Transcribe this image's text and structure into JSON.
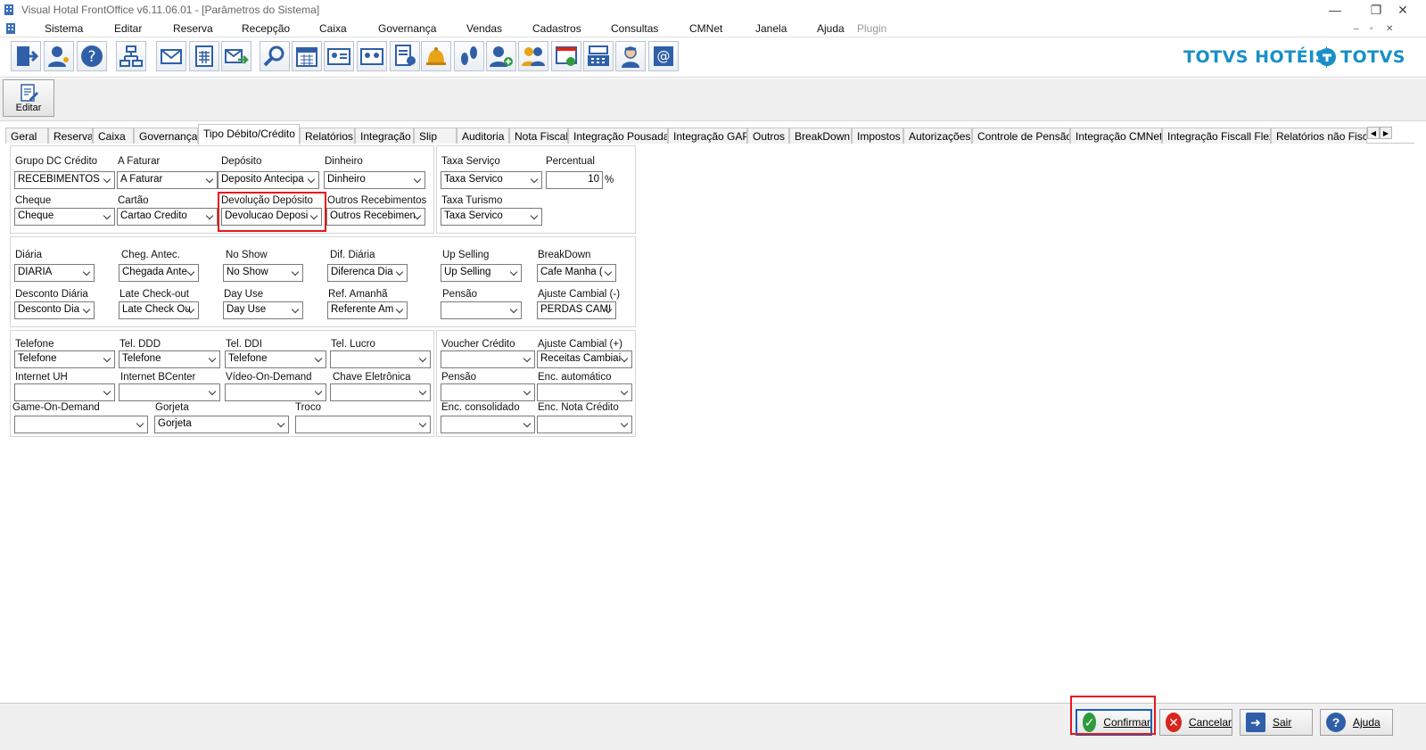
{
  "window": {
    "title": "Visual Hotal FrontOffice v6.11.06.01 - [Parâmetros do Sistema]",
    "minimize": "—",
    "restore": "❐",
    "close": "✕"
  },
  "menu": {
    "items": [
      "Sistema",
      "Editar",
      "Reserva",
      "Recepção",
      "Caixa",
      "Governança",
      "Vendas",
      "Cadastros",
      "Consultas",
      "CMNet",
      "Janela",
      "Ajuda"
    ],
    "plugin": "Plugin",
    "mdi": [
      "–",
      "▫",
      "✕"
    ]
  },
  "toolbar": {
    "icons": [
      "exit-icon",
      "user-key-icon",
      "help-icon",
      "org-chart-icon",
      "mail-icon",
      "calculator-icon",
      "mail-send-icon",
      "search-icon",
      "calendar-icon",
      "guest-card-icon",
      "guest-card-2-icon",
      "document-user-icon",
      "bell-icon",
      "footprints-icon",
      "add-user-icon",
      "users-group-icon",
      "invoice-icon",
      "cash-register-icon",
      "maid-icon",
      "email-at-icon"
    ],
    "brand_hotels": "TOTVS HOTÉIS",
    "brand_totvs": "TOTVS"
  },
  "subbar": {
    "edit_label": "Editar"
  },
  "tabs": {
    "items": [
      "Geral",
      "Reserva",
      "Caixa",
      "Governança",
      "Tipo Débito/Crédito",
      "Relatórios",
      "Integração",
      "Slip",
      "Auditoria",
      "Nota Fiscal",
      "Integração Pousada",
      "Integração GAP",
      "Outros",
      "BreakDown",
      "Impostos",
      "Autorizações",
      "Controle de Pensão",
      "Integração CMNet",
      "Integração Fiscall Flex",
      "Relatórios não Fiscais"
    ],
    "active": "Tipo Débito/Crédito",
    "scroll_left": "◀",
    "scroll_right": "▶"
  },
  "panel1": {
    "grupo_dc_label": "Grupo DC Crédito",
    "grupo_dc_value": "RECEBIMENTOS",
    "a_faturar_label": "A Faturar",
    "a_faturar_value": "A Faturar",
    "deposito_label": "Depósito",
    "deposito_value": "Deposito Antecipa",
    "dinheiro_label": "Dinheiro",
    "dinheiro_value": "Dinheiro",
    "cheque_label": "Cheque",
    "cheque_value": "Cheque",
    "cartao_label": "Cartão",
    "cartao_value": "Cartao Credito",
    "devolucao_label": "Devolução Depósito",
    "devolucao_value": "Devolucao Deposi",
    "outros_label": "Outros Recebimentos",
    "outros_value": "Outros Recebimen"
  },
  "panel2": {
    "taxa_servico_label": "Taxa Serviço",
    "taxa_servico_value": "Taxa Servico",
    "percentual_label": "Percentual",
    "percentual_value": "10",
    "percent_sign": "%",
    "taxa_turismo_label": "Taxa Turismo",
    "taxa_turismo_value": "Taxa Servico"
  },
  "panel3": {
    "diaria_label": "Diária",
    "diaria_value": "DIARIA",
    "cheg_antec_label": "Cheg. Antec.",
    "cheg_antec_value": "Chegada Ante",
    "no_show_label": "No Show",
    "no_show_value": "No Show",
    "dif_diaria_label": "Dif. Diária",
    "dif_diaria_value": "Diferenca Dia",
    "up_selling_label": "Up Selling",
    "up_selling_value": "Up Selling",
    "breakdown_label": "BreakDown",
    "breakdown_value": "Cafe Manha (",
    "desconto_label": "Desconto Diária",
    "desconto_value": "Desconto Dia",
    "late_checkout_label": "Late Check-out",
    "late_checkout_value": "Late Check Ou",
    "day_use_label": "Day Use",
    "day_use_value": "Day Use",
    "ref_amanha_label": "Ref. Amanhã",
    "ref_amanha_value": "Referente Am",
    "pensao_label": "Pensão",
    "pensao_value": "",
    "ajuste_neg_label": "Ajuste Cambial (-)",
    "ajuste_neg_value": "PERDAS CAMI"
  },
  "panel4": {
    "telefone_label": "Telefone",
    "telefone_value": "Telefone",
    "tel_ddd_label": "Tel. DDD",
    "tel_ddd_value": "Telefone",
    "tel_ddi_label": "Tel. DDI",
    "tel_ddi_value": "Telefone",
    "tel_lucro_label": "Tel. Lucro",
    "tel_lucro_value": "",
    "internet_uh_label": "Internet UH",
    "internet_uh_value": "",
    "internet_bc_label": "Internet BCenter",
    "internet_bc_value": "",
    "video_label": "Vídeo-On-Demand",
    "video_value": "",
    "chave_label": "Chave Eletrônica",
    "chave_value": "",
    "game_label": "Game-On-Demand",
    "game_value": "",
    "gorjeta_label": "Gorjeta",
    "gorjeta_value": "Gorjeta",
    "troco_label": "Troco",
    "troco_value": ""
  },
  "panel5": {
    "voucher_label": "Voucher Crédito",
    "voucher_value": "",
    "ajuste_pos_label": "Ajuste Cambial (+)",
    "ajuste_pos_value": "Receitas Cambiai",
    "pensao_label": "Pensão",
    "pensao_value": "",
    "enc_auto_label": "Enc. automático",
    "enc_auto_value": "",
    "enc_cons_label": "Enc. consolidado",
    "enc_cons_value": "",
    "enc_nota_label": "Enc. Nota Crédito",
    "enc_nota_value": ""
  },
  "buttons": {
    "confirmar": "Confirmar",
    "cancelar": "Cancelar",
    "sair": "Sair",
    "ajuda": "Ajuda"
  },
  "colors": {
    "highlight": "#e8161b",
    "brand": "#1a8fc7",
    "confirm_green": "#2e9a3e",
    "cancel_red": "#d9261c",
    "exit_blue": "#2f5fa8"
  }
}
